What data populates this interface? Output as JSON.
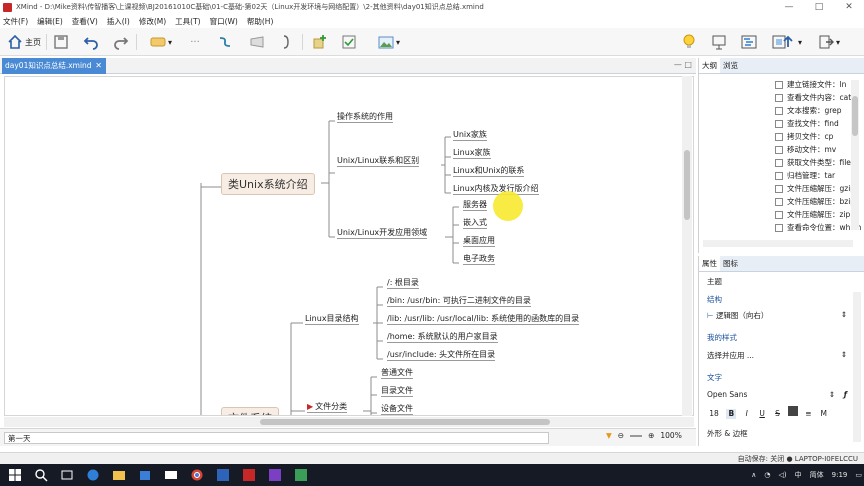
{
  "window": {
    "title": "XMind - D:\\Mike资料\\传智播客\\上课视频\\BJ20161010C基础\\01-C基础-第02天（Linux开发环境与网络配置）\\2-其他资料\\day01知识点总结.xmind",
    "min": "—",
    "max": "□",
    "close": "✕"
  },
  "menu": [
    "文件(F)",
    "编辑(E)",
    "查看(V)",
    "插入(I)",
    "修改(M)",
    "工具(T)",
    "窗口(W)",
    "帮助(H)"
  ],
  "toolbar": {
    "home_label": "主页"
  },
  "editor_tab": {
    "label": "day01知识点总结.xmind",
    "close": "✕"
  },
  "mindmap": {
    "topic1": "类Unix系统介绍",
    "t1_children": [
      "操作系统的作用",
      "Unix/Linux联系和区别",
      "Unix/Linux开发应用领域"
    ],
    "diff_children": [
      "Unix家族",
      "Linux家族",
      "Linux和Unix的联系",
      "Linux内核及发行版介绍"
    ],
    "domain_children": [
      "服务器",
      "嵌入式",
      "桌面应用",
      "电子政务"
    ],
    "topic2": "文件系统",
    "dir_structure": "Linux目录结构",
    "dir_children": [
      "/: 根目录",
      "/bin: /usr/bin: 可执行二进制文件的目录",
      "/lib: /usr/lib: /usr/local/lib: 系统使用的函数库的目录",
      "/home: 系统默认的用户家目录",
      "/usr/include: 头文件所在目录"
    ],
    "file_types": "文件分类",
    "file_type_children": [
      "普通文件",
      "目录文件",
      "设备文件"
    ]
  },
  "sheet": {
    "name": "第一天",
    "zoom": "100%"
  },
  "outline_panel": {
    "tabs": [
      "大纲",
      "浏览"
    ],
    "items": [
      "建立链接文件：ln",
      "查看文件内容：cat",
      "文本搜索：grep",
      "查找文件：find",
      "拷贝文件：cp",
      "移动文件：mv",
      "获取文件类型：file",
      "归档管理：tar",
      "文件压缩解压：gzip",
      "文件压缩解压：bzip2",
      "文件压缩解压：zip",
      "查看命令位置：which"
    ]
  },
  "props_panel": {
    "tabs": [
      "属性",
      "图标"
    ],
    "section_topic": "主题",
    "structure_label": "结构",
    "structure_value": "逻辑图（向右）",
    "my_style_label": "我的样式",
    "my_style_value": "选择并应用 ...",
    "text_label": "文字",
    "font_name": "Open Sans",
    "font_size": "18",
    "bold": "B",
    "italic": "I",
    "underline": "U",
    "strike": "S",
    "color_label": "M",
    "shape_label": "外形 & 边框"
  },
  "status": {
    "autosave": "自动保存: 关闭",
    "user": "LAPTOP-I0FELCCU"
  },
  "taskbar": {
    "lang": "简体",
    "time": "9:19",
    "ime": "中"
  },
  "colors": {
    "accent": "#4a8ad4",
    "topic_fill": "#f7ede4",
    "cursor": "#f7e930",
    "taskbar": "#151a24"
  }
}
